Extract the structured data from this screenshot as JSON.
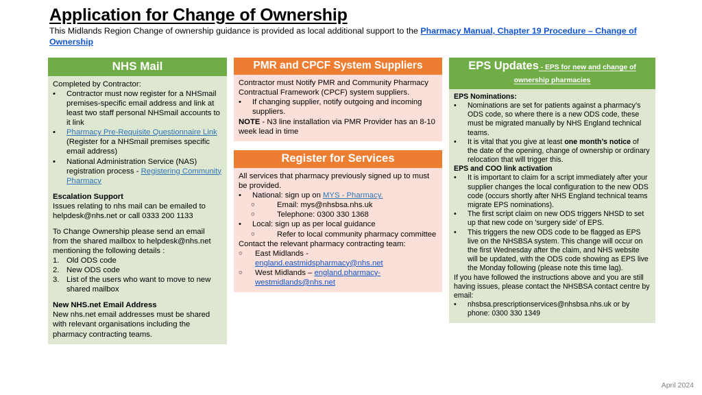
{
  "header": {
    "title": "Application for Change of Ownership",
    "intro_before": "This Midlands Region Change of ownership guidance is provided as local additional support to the ",
    "intro_link": "Pharmacy Manual, Chapter 19 Procedure – Change of Ownership"
  },
  "columns": {
    "nhs_mail": {
      "header": "NHS Mail",
      "header_color": "#70AD47",
      "body_color": "#DDE7D2",
      "lead": "Completed by Contractor:",
      "bullets": [
        "Contractor must now register for a NHSmail premises-specific email address and link at least two staff personal NHSmail accounts to it link",
        "(Register for a NHSmail premises specific email address)",
        "National Administration Service (NAS) registration process -"
      ],
      "bullet2_link": "Pharmacy Pre-Requisite Questionnaire Link",
      "bullet3_link": "Registering Community Pharmacy",
      "escalation_title": "Escalation Support",
      "escalation_text": "Issues relating to nhs mail can be emailed to helpdesk@nhs.net or call 0333 200 1133",
      "change_text": "To Change Ownership please send  an email from the shared mailbox to helpdesk@nhs.net mentioning the following details :",
      "numbered": [
        "Old ODS code",
        "New ODS code",
        "List of the users who want to move to new shared mailbox"
      ],
      "new_email_title": "New NHS.net Email Address",
      "new_email_text": "New nhs.net email addresses must be shared with relevant organisations including the pharmacy contracting teams."
    },
    "pmr": {
      "header": "PMR and CPCF System Suppliers",
      "header_color": "#ED7D31",
      "body_color": "#FAE0D9",
      "lead": "Contractor must Notify PMR and Community Pharmacy Contractual Framework (CPCF) system suppliers.",
      "bullets": [
        "If changing supplier, notify outgoing and incoming suppliers."
      ],
      "note_label": "NOTE",
      "note_text": " - N3 line installation via PMR Provider has an 8-10 week lead in time"
    },
    "register": {
      "header": "Register for Services",
      "header_color": "#ED7D31",
      "body_color": "#FAE0D9",
      "lead": "All services that pharmacy previously signed up to must be provided.",
      "national_before": "National: sign up on ",
      "national_link": "MYS - Pharmacy.",
      "national_sub": [
        "Email: mys@nhsbsa.nhs.uk",
        "Telephone: 0300 330 1368"
      ],
      "local": "Local: sign up as per local guidance",
      "local_sub": [
        "Refer to local community pharmacy committee"
      ],
      "contact_lead": "Contact the relevant pharmacy contracting team:",
      "contacts": [
        {
          "region": "East Midlands -",
          "email": "england.eastmidspharmacy@nhs.net"
        },
        {
          "region": "West Midlands –",
          "email": "england.pharmacy-westmidlands@nhs.net"
        }
      ]
    },
    "eps": {
      "header": "EPS Updates",
      "header_sub": "EPS for new and change of ownership pharmacies",
      "header_color": "#70AD47",
      "body_color": "#DDE7D2",
      "nominations_title": "EPS Nominations:",
      "nom_b1": "Nominations are set for patients against a pharmacy’s ODS code, so where there is a new ODS code, these must be migrated manually by NHS England technical teams.",
      "nom_b2_a": "It is vital that you give at least ",
      "nom_b2_bold": "one month’s notice",
      "nom_b2_b": " of the date of the opening, change of ownership or ordinary relocation that will trigger this.",
      "coo_title": "EPS and COO link activation",
      "coo_bullets": [
        "It is important to claim for a script immediately after your supplier changes the local configuration to the new ODS code (occurs shortly after NHS England technical teams migrate EPS nominations).",
        "The first script claim on new ODS triggers NHSD to set up that new code on 'surgery side' of EPS.",
        "This triggers the new ODS code to be flagged as EPS live on the NHSBSA system. This change will occur on the first Wednesday after the claim, and NHS website will be updated, with the ODS code showing as EPS live the Monday following (please note this time lag)."
      ],
      "closing_text": "If you have followed the instructions above and you are still having issues, please contact the NHSBSA contact centre by email:",
      "closing_bullet": "nhsbsa.prescriptionservices@nhsbsa.nhs.uk or by phone: 0300 330 1349"
    }
  },
  "footer": {
    "date": "April 2024"
  }
}
